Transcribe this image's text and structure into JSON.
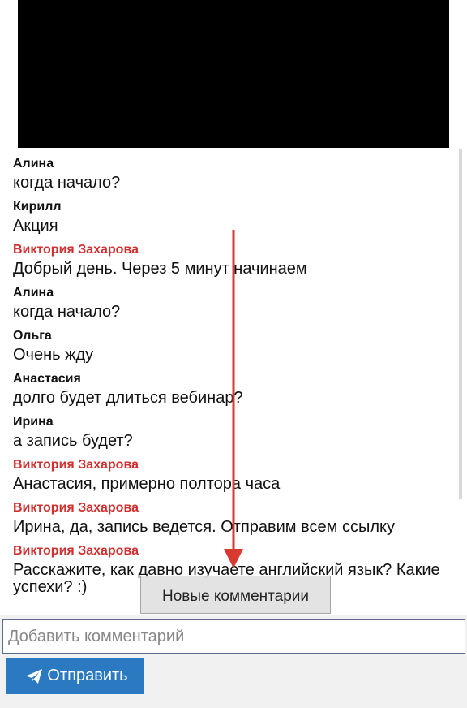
{
  "chat": {
    "messages": [
      {
        "author": "Алина",
        "text": "когда начало?",
        "staff": false
      },
      {
        "author": "Кирилл",
        "text": "Акция",
        "staff": false
      },
      {
        "author": "Виктория Захарова",
        "text": "Добрый день. Через 5 минут начинаем",
        "staff": true
      },
      {
        "author": "Алина",
        "text": "когда начало?",
        "staff": false
      },
      {
        "author": "Ольга",
        "text": "Очень жду",
        "staff": false
      },
      {
        "author": "Анастасия",
        "text": "долго будет длиться вебинар?",
        "staff": false
      },
      {
        "author": "Ирина",
        "text": "а запись будет?",
        "staff": false
      },
      {
        "author": "Виктория Захарова",
        "text": "Анастасия, примерно полтора часа",
        "staff": true
      },
      {
        "author": "Виктория Захарова",
        "text": "Ирина, да, запись ведется. Отправим всем ссылку",
        "staff": true
      },
      {
        "author": "Виктория Захарова",
        "text": "Расскажите, как давно изучаете английский язык? Какие успехи? :)",
        "staff": true
      }
    ],
    "new_comments_label": "Новые комментарии"
  },
  "composer": {
    "input_placeholder": "Добавить комментарий",
    "input_value": "",
    "send_label": "Отправить"
  },
  "colors": {
    "staff_author": "#d32f2f",
    "send_button": "#2b7ac1",
    "arrow": "#d93a2f",
    "video_background": "#000000"
  },
  "icons": {
    "send": "paper-plane-icon",
    "annotation": "arrow-down-icon"
  }
}
